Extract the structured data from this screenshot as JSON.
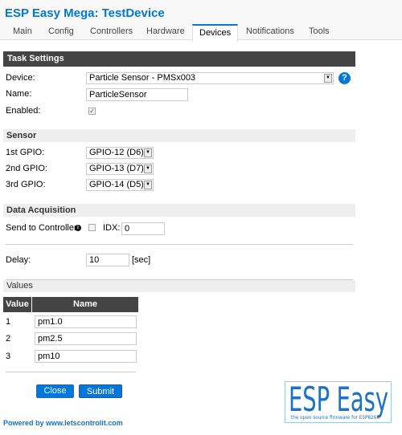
{
  "header": {
    "title": "ESP Easy Mega: TestDevice"
  },
  "tabs": [
    {
      "label": "Main"
    },
    {
      "label": "Config"
    },
    {
      "label": "Controllers"
    },
    {
      "label": "Hardware"
    },
    {
      "label": "Devices",
      "active": true
    },
    {
      "label": "Notifications"
    },
    {
      "label": "Tools"
    }
  ],
  "task_settings": {
    "heading": "Task Settings",
    "device_label": "Device:",
    "device_value": "Particle Sensor - PMSx003",
    "name_label": "Name:",
    "name_value": "ParticleSensor",
    "enabled_label": "Enabled:",
    "enabled": true
  },
  "sensor": {
    "heading": "Sensor",
    "gpios": [
      {
        "label": "1st GPIO:",
        "value": "GPIO-12 (D6)"
      },
      {
        "label": "2nd GPIO:",
        "value": "GPIO-13 (D7)"
      },
      {
        "label": "3rd GPIO:",
        "value": "GPIO-14 (D5)"
      }
    ]
  },
  "data_acquisition": {
    "heading": "Data Acquisition",
    "send_label": "Send to Controller",
    "send_checked": false,
    "idx_label": "IDX:",
    "idx_value": "0",
    "delay_label": "Delay:",
    "delay_value": "10",
    "delay_unit": "[sec]"
  },
  "values": {
    "heading": "Values",
    "columns": [
      "Value",
      "Name"
    ],
    "rows": [
      {
        "num": "1",
        "name": "pm1.0"
      },
      {
        "num": "2",
        "name": "pm2.5"
      },
      {
        "num": "3",
        "name": "pm10"
      }
    ]
  },
  "buttons": {
    "close": "Close",
    "submit": "Submit"
  },
  "footer": {
    "powered": "Powered by www.letscontrolit.com"
  },
  "logo": {
    "text": "ESP Easy",
    "tagline": "the open source firmware for ESP8266"
  },
  "colors": {
    "accent": "#0077dd",
    "dark_bar": "#444444",
    "light_bar": "#eeeeee"
  }
}
